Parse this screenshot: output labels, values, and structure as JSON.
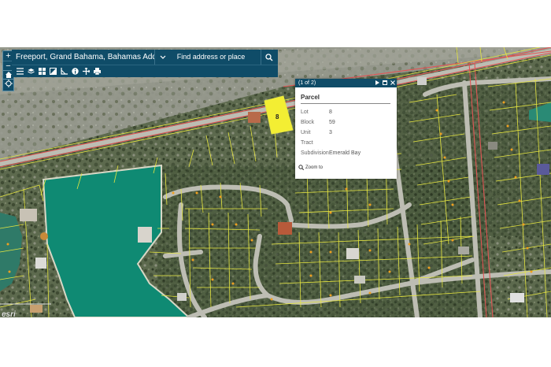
{
  "app": {
    "title": "Freeport, Grand Bahama, Bahamas Addresses"
  },
  "search": {
    "placeholder": "Find address or place"
  },
  "zoom": {
    "in": "+",
    "out": "−"
  },
  "map": {
    "selected_parcel_label": "8",
    "colors": {
      "parcel_line": "#e6e640",
      "road_line": "#e05555",
      "selected_fill": "#f3ee33",
      "water": "#0f8a73",
      "header_bg": "#0f4c68"
    }
  },
  "popup": {
    "counter": "(1 of 2)",
    "title": "Parcel",
    "fields": [
      {
        "key": "Lot",
        "value": "8"
      },
      {
        "key": "Block",
        "value": "59"
      },
      {
        "key": "Unit",
        "value": "3"
      },
      {
        "key": "Tract",
        "value": ""
      },
      {
        "key": "Subdivision",
        "value": "Emerald Bay"
      }
    ],
    "zoom_to": "Zoom to"
  },
  "attribution": "esri",
  "toolbar_icons": [
    "list-icon",
    "layers-icon",
    "basemap-gallery-icon",
    "legend-icon",
    "measure-icon",
    "info-icon",
    "share-icon",
    "print-icon"
  ]
}
